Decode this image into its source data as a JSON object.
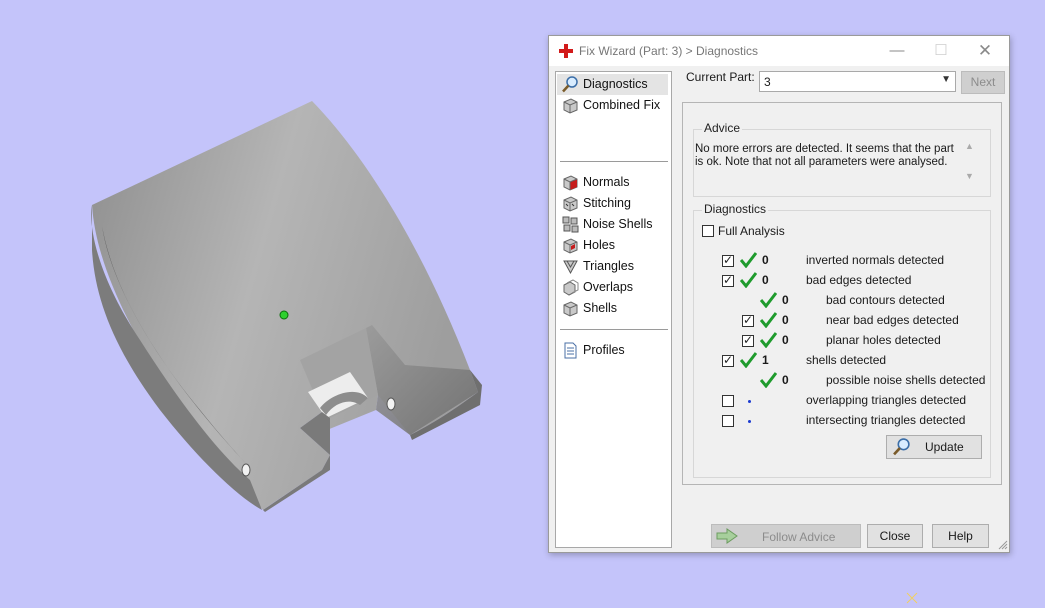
{
  "dialog": {
    "title": "Fix Wizard (Part: 3) > Diagnostics",
    "nav": {
      "top": [
        {
          "label": "Diagnostics",
          "icon": "magnifier-icon",
          "selected": true
        },
        {
          "label": "Combined Fix",
          "icon": "cube-icon"
        }
      ],
      "fixes": [
        {
          "label": "Normals",
          "icon": "normals-cube-icon"
        },
        {
          "label": "Stitching",
          "icon": "stitching-cube-icon"
        },
        {
          "label": "Noise Shells",
          "icon": "noise-shells-icon"
        },
        {
          "label": "Holes",
          "icon": "holes-cube-icon"
        },
        {
          "label": "Triangles",
          "icon": "triangles-icon"
        },
        {
          "label": "Overlaps",
          "icon": "overlaps-cube-icon"
        },
        {
          "label": "Shells",
          "icon": "shells-cube-icon"
        }
      ],
      "bottom": [
        {
          "label": "Profiles",
          "icon": "document-icon"
        }
      ]
    },
    "current_part_label": "Current Part:",
    "current_part_value": "3",
    "next_label": "Next",
    "advice": {
      "title": "Advice",
      "text": "No more errors are detected. It seems that the part is ok. Note that not all parameters were analysed."
    },
    "diagnostics": {
      "title": "Diagnostics",
      "full_analysis_label": "Full Analysis",
      "full_analysis_checked": false,
      "rows": [
        {
          "checkbox": true,
          "checked": true,
          "status": "ok",
          "count": "0",
          "label": "inverted normals detected",
          "indent": 0
        },
        {
          "checkbox": true,
          "checked": true,
          "status": "ok",
          "count": "0",
          "label": "bad edges detected",
          "indent": 0
        },
        {
          "checkbox": false,
          "checked": false,
          "status": "ok",
          "count": "0",
          "label": "bad contours detected",
          "indent": 1
        },
        {
          "checkbox": true,
          "checked": true,
          "status": "ok",
          "count": "0",
          "label": "near bad edges detected",
          "indent": 1
        },
        {
          "checkbox": true,
          "checked": true,
          "status": "ok",
          "count": "0",
          "label": "planar holes detected",
          "indent": 1
        },
        {
          "checkbox": true,
          "checked": true,
          "status": "ok",
          "count": "1",
          "label": "shells detected",
          "indent": 0
        },
        {
          "checkbox": false,
          "checked": false,
          "status": "ok",
          "count": "0",
          "label": "possible noise shells detected",
          "indent": 1
        },
        {
          "checkbox": true,
          "checked": false,
          "status": "pending",
          "count": "",
          "label": "overlapping triangles detected",
          "indent": 0
        },
        {
          "checkbox": true,
          "checked": false,
          "status": "pending",
          "count": "",
          "label": "intersecting triangles detected",
          "indent": 0
        }
      ],
      "update_label": "Update"
    },
    "follow_advice_label": "Follow Advice",
    "close_label": "Close",
    "help_label": "Help"
  },
  "colors": {
    "background": "#c4c4fa",
    "check_green": "#1f9b2d",
    "dot_blue": "#1c3bd0",
    "part_gray": "#9a9a9a"
  }
}
